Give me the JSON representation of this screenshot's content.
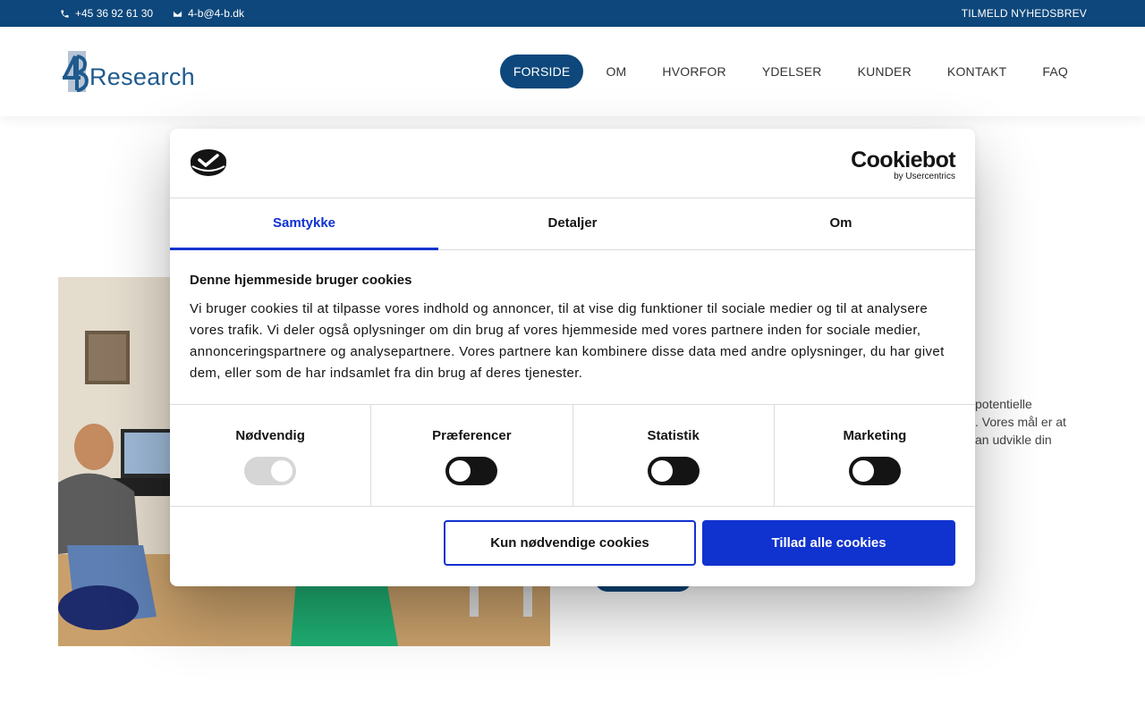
{
  "topbar": {
    "phone": "+45 36 92 61 30",
    "email": "4-b@4-b.dk",
    "newsletter_label": "TILMELD NYHEDSBREV"
  },
  "header": {
    "logo_text": "Research",
    "nav": [
      {
        "label": "FORSIDE",
        "active": true
      },
      {
        "label": "OM"
      },
      {
        "label": "HVORFOR"
      },
      {
        "label": "YDELSER"
      },
      {
        "label": "KUNDER"
      },
      {
        "label": "KONTAKT"
      },
      {
        "label": "FAQ"
      }
    ]
  },
  "page": {
    "partial_text": [
      "potentielle",
      ". Vores mål er at",
      "an udvikle din"
    ]
  },
  "cookie_dialog": {
    "brand_name": "Cookiebot",
    "brand_sub": "by Usercentrics",
    "tabs": [
      {
        "label": "Samtykke",
        "active": true
      },
      {
        "label": "Detaljer"
      },
      {
        "label": "Om"
      }
    ],
    "heading": "Denne hjemmeside bruger cookies",
    "body": "Vi bruger cookies til at tilpasse vores indhold og annoncer, til at vise dig funktioner til sociale medier og til at analysere vores trafik. Vi deler også oplysninger om din brug af vores hjemmeside med vores partnere inden for sociale medier, annonceringspartnere og analysepartnere. Vores partnere kan kombinere disse data med andre oplysninger, du har givet dem, eller som de har indsamlet fra din brug af deres tjenester.",
    "categories": [
      {
        "label": "Nødvendig",
        "enabled": true,
        "locked": true
      },
      {
        "label": "Præferencer",
        "enabled": false
      },
      {
        "label": "Statistik",
        "enabled": false
      },
      {
        "label": "Marketing",
        "enabled": false
      }
    ],
    "btn_necessary": "Kun nødvendige cookies",
    "btn_allow_all": "Tillad alle cookies"
  },
  "colors": {
    "brand_blue": "#0d477b",
    "cookiebot_blue": "#1032cf"
  },
  "icons": [
    "phone-icon",
    "mail-icon",
    "cookiebot-logo-icon"
  ]
}
